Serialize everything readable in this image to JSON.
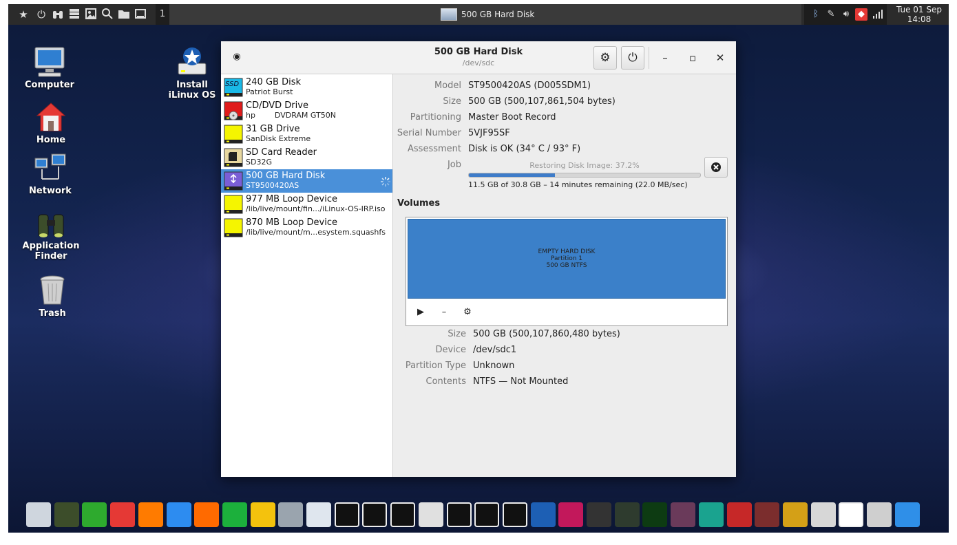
{
  "top_panel": {
    "workspace": "1",
    "task_title": "500 GB Hard Disk",
    "clock_date": "Tue 01 Sep",
    "clock_time": "14:08"
  },
  "desktop_icons": [
    {
      "label": "Computer"
    },
    {
      "label": "Install iLinux OS"
    },
    {
      "label": "Home"
    },
    {
      "label": "Network"
    },
    {
      "label": "Application Finder"
    },
    {
      "label": "Trash"
    }
  ],
  "window": {
    "title": "500 GB Hard Disk",
    "subtitle": "/dev/sdc"
  },
  "drives": [
    {
      "name": "240 GB Disk",
      "sub": "Patriot Burst",
      "icon": "ssd-icon",
      "icon_text": "SSD",
      "color": "#19b8e6"
    },
    {
      "name": "CD/DVD Drive",
      "sub": "hp        DVDRAM GT50N",
      "icon": "optical-drive-icon",
      "color": "#e01b1b"
    },
    {
      "name": "31 GB Drive",
      "sub": "SanDisk Extreme",
      "icon": "usb-drive-icon",
      "color": "#f5f500"
    },
    {
      "name": "SD Card Reader",
      "sub": "SD32G",
      "icon": "sd-card-icon",
      "color": "#e8d8a0"
    },
    {
      "name": "500 GB Hard Disk",
      "sub": "ST9500420AS",
      "icon": "usb-hard-disk-icon",
      "color": "#7b5ed6",
      "selected": true
    },
    {
      "name": "977 MB Loop Device",
      "sub": "/lib/live/mount/fin.../iLinux-OS-IRP.iso",
      "icon": "loop-device-icon",
      "color": "#f5f500"
    },
    {
      "name": "870 MB Loop Device",
      "sub": "/lib/live/mount/m...esystem.squashfs",
      "icon": "loop-device-icon",
      "color": "#f5f500"
    }
  ],
  "disk_props": [
    {
      "label": "Model",
      "value": "ST9500420AS (D005SDM1)"
    },
    {
      "label": "Size",
      "value": "500 GB (500,107,861,504 bytes)"
    },
    {
      "label": "Partitioning",
      "value": "Master Boot Record"
    },
    {
      "label": "Serial Number",
      "value": "5VJF95SF"
    },
    {
      "label": "Assessment",
      "value": "Disk is OK (34° C / 93° F)"
    }
  ],
  "job": {
    "label": "Job",
    "caption": "Restoring Disk Image: 37.2%",
    "progress": 0.372,
    "status": "11.5 GB of 30.8 GB – 14 minutes remaining (22.0 MB/sec)"
  },
  "volumes": {
    "heading": "Volumes",
    "partition_lines": [
      "EMPTY HARD DISK",
      "Partition 1",
      "500 GB NTFS"
    ],
    "partition_color": "#3b80c9"
  },
  "volume_props": [
    {
      "label": "Size",
      "value": "500 GB (500,107,860,480 bytes)"
    },
    {
      "label": "Device",
      "value": "/dev/sdc1"
    },
    {
      "label": "Partition Type",
      "value": "Unknown"
    },
    {
      "label": "Contents",
      "value": "NTFS — Not Mounted"
    }
  ],
  "dock_apps": [
    "file-cabinet-icon",
    "binoculars-icon",
    "green-pipe-icon",
    "anydesk-icon",
    "firefox-icon",
    "wps-writer-icon",
    "wps-presentation-icon",
    "wps-spreadsheets-icon",
    "teapot-icon",
    "scanner-icon",
    "pencil-icon",
    "system-tools-icon",
    "disk-usage-icon",
    "health-monitor-icon",
    "color-picker-icon",
    "magnifier-icon",
    "disks-download-icon",
    "installer-icon",
    "installer-2-icon",
    "sync-icon",
    "scanner-flat-icon",
    "system-monitor-icon",
    "radar-icon",
    "photo-editor-icon",
    "runner-icon",
    "terminal-red-icon",
    "terminal-icon",
    "lock-settings-icon",
    "media-drive-icon",
    "power-icon",
    "trash-icon",
    "window-icon"
  ]
}
